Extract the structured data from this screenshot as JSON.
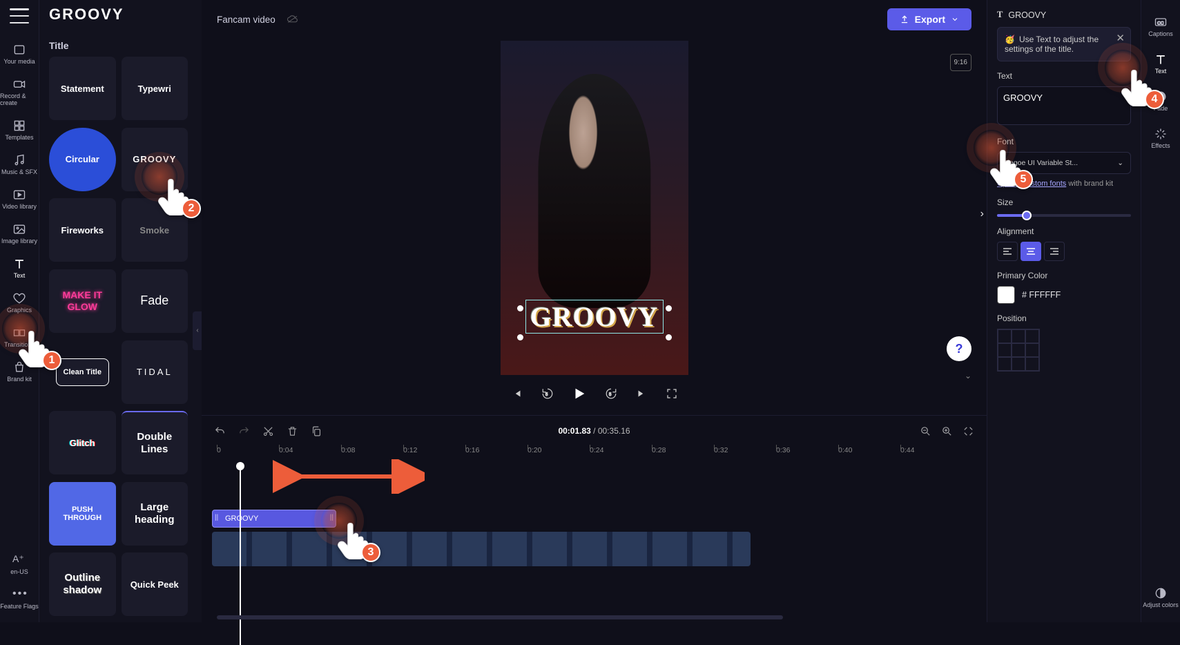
{
  "project": {
    "name": "Fancam video"
  },
  "export": {
    "label": "Export"
  },
  "rail": {
    "your_media": "Your media",
    "record": "Record & create",
    "templates": "Templates",
    "music": "Music & SFX",
    "video": "Video library",
    "image": "Image library",
    "text": "Text",
    "graphics": "Graphics",
    "transitions": "Transitions",
    "brand": "Brand kit",
    "locale": "en-US",
    "flags": "Feature Flags"
  },
  "left": {
    "header": "GROOVY",
    "section": "Title",
    "tiles": [
      "Statement",
      "Typewri",
      "Circular",
      "GROOVY",
      "Fireworks",
      "Smoke",
      "MAKE IT GLOW",
      "Fade",
      "Clean Title",
      "TIDAL",
      "Glitch",
      "Double Lines",
      "PUSH THROUGH",
      "Large heading",
      "Outline shadow",
      "Quick Peek"
    ]
  },
  "canvas": {
    "overlay": "GROOVY",
    "aspect": "9:16"
  },
  "timeline": {
    "current": "00:01.83",
    "total": "00:35.16",
    "marks": [
      "0",
      "0:04",
      "0:08",
      "0:12",
      "0:16",
      "0:20",
      "0:24",
      "0:28",
      "0:32",
      "0:36",
      "0:40",
      "0:44"
    ],
    "text_clip": "GROOVY"
  },
  "props": {
    "crumb_icon": "T",
    "crumb": "GROOVY",
    "tip": "Use Text to adjust the settings of the title.",
    "text_label": "Text",
    "text_value": "GROOVY",
    "font_label": "Font",
    "font_value": "Segoe UI Variable St...",
    "upload_fonts": "Upload custom fonts",
    "upload_kit": " with brand kit",
    "size_label": "Size",
    "align_label": "Alignment",
    "color_label": "Primary Color",
    "color_value": "# FFFFFF",
    "position_label": "Position"
  },
  "rrail": {
    "captions": "Captions",
    "text": "Text",
    "fade": "Fade",
    "effects": "Effects",
    "colors": "Adjust colors"
  },
  "annotations": {
    "n1": "1",
    "n2": "2",
    "n3": "3",
    "n4": "4",
    "n5": "5"
  }
}
